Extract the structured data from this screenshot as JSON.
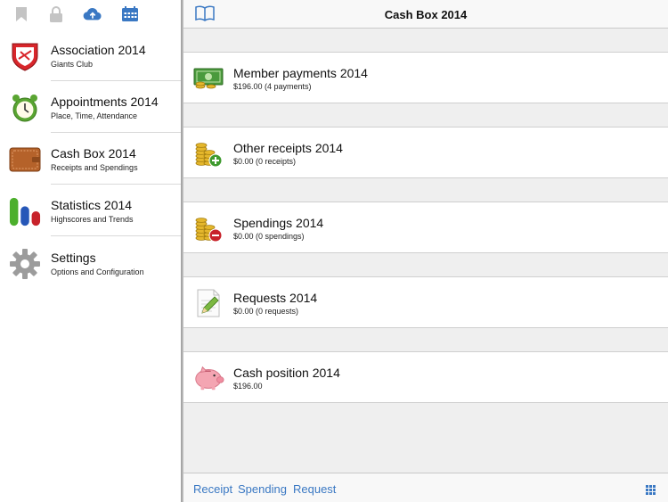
{
  "sidebar": {
    "toolbar_icons": [
      "bookmark-icon",
      "lock-icon",
      "cloud-upload-icon",
      "calendar-icon"
    ],
    "items": [
      {
        "title": "Association 2014",
        "subtitle": "Giants Club",
        "icon": "club-crest-icon"
      },
      {
        "title": "Appointments 2014",
        "subtitle": "Place, Time, Attendance",
        "icon": "alarm-clock-icon"
      },
      {
        "title": "Cash Box 2014",
        "subtitle": "Receipts and Spendings",
        "icon": "wallet-icon"
      },
      {
        "title": "Statistics 2014",
        "subtitle": "Highscores and Trends",
        "icon": "bar-chart-icon"
      },
      {
        "title": "Settings",
        "subtitle": "Options and Configuration",
        "icon": "gear-icon"
      }
    ]
  },
  "main": {
    "title": "Cash Box 2014",
    "rows": [
      {
        "title": "Member payments 2014",
        "subtitle": "$196.00 (4 payments)",
        "icon": "banknote-coins-icon"
      },
      {
        "title": "Other receipts 2014",
        "subtitle": "$0.00 (0 receipts)",
        "icon": "coins-plus-icon"
      },
      {
        "title": "Spendings 2014",
        "subtitle": "$0.00 (0 spendings)",
        "icon": "coins-minus-icon"
      },
      {
        "title": "Requests 2014",
        "subtitle": "$0.00 (0 requests)",
        "icon": "pencil-paper-icon"
      },
      {
        "title": "Cash position 2014",
        "subtitle": "$196.00",
        "icon": "piggy-bank-icon"
      }
    ],
    "footer": {
      "receipt_label": "Receipt",
      "spending_label": "Spending",
      "request_label": "Request"
    }
  },
  "colors": {
    "accent": "#3a78c3",
    "sidebar_bg": "#ffffff",
    "main_bg": "#efefef",
    "separator": "#cfcfcf"
  }
}
